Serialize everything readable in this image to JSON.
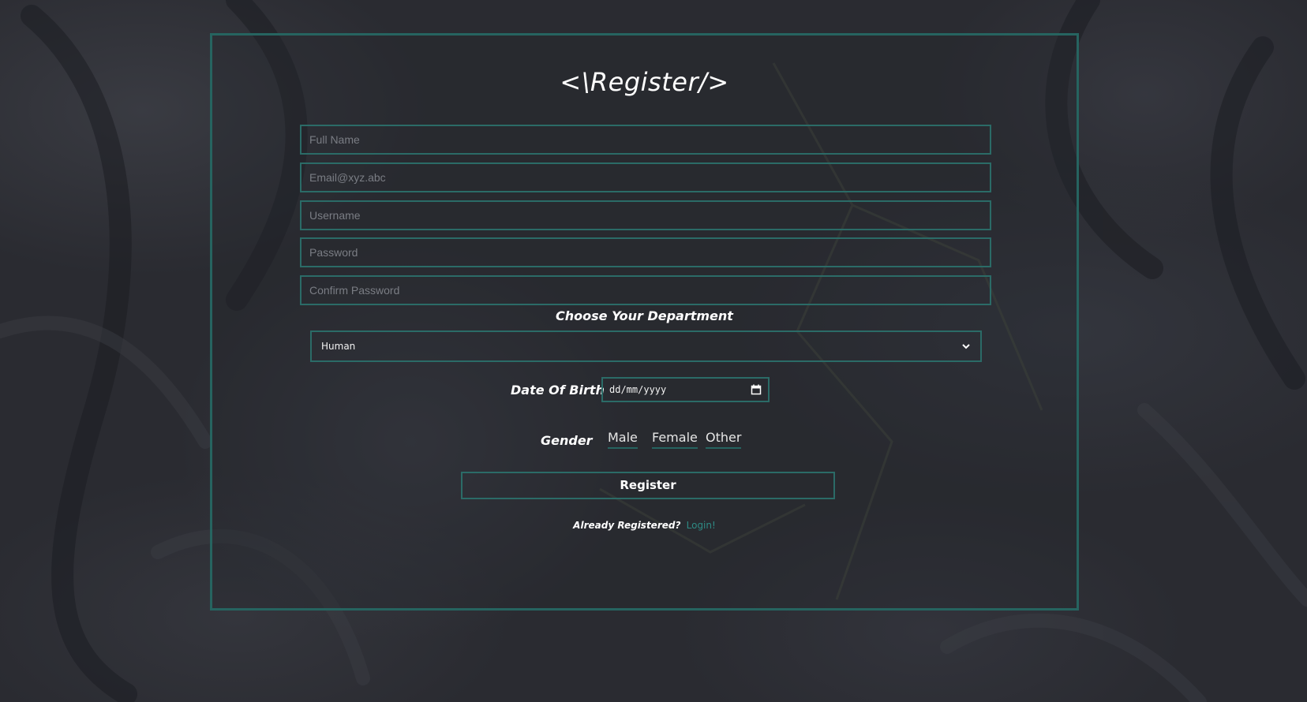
{
  "page": {
    "title": "<\\Register/>"
  },
  "form": {
    "full_name_placeholder": "Full Name",
    "email_placeholder": "Email@xyz.abc",
    "username_placeholder": "Username",
    "password_placeholder": "Password",
    "confirm_password_placeholder": "Confirm Password",
    "department_label": "Choose Your Department",
    "department_selected": "Human",
    "dob_label": "Date Of Birth",
    "dob_placeholder": "dd/mm/yyyy",
    "gender_label": "Gender",
    "gender_options": [
      "Male",
      "Female",
      "Other"
    ],
    "register_label": "Register",
    "already_text": "Already Registered?",
    "login_link": "Login!"
  },
  "icons": {
    "department_dropdown": "chevron-down-icon",
    "dob_picker": "calendar-icon"
  },
  "colors": {
    "accent": "#266460",
    "link": "#2e8a84",
    "background": "#2a2b31"
  }
}
